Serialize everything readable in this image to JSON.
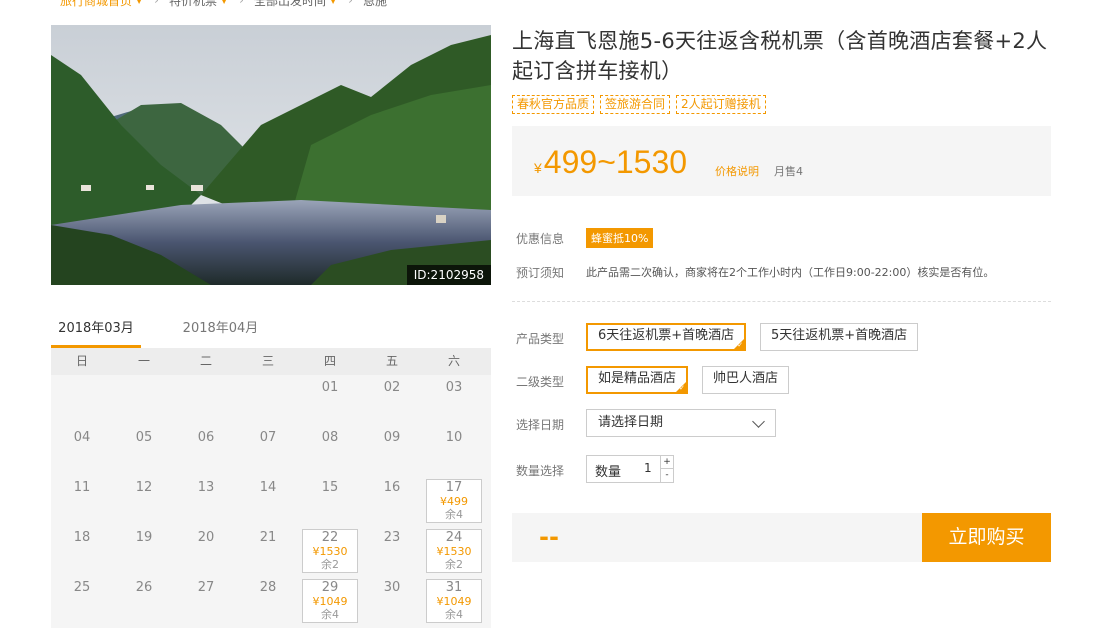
{
  "breadcrumb": [
    {
      "label": "旅行商城首页",
      "caret": "▼",
      "sep": "›"
    },
    {
      "label": "特价机票",
      "caret": "▼",
      "sep": "›"
    },
    {
      "label": "全部出发时间",
      "caret": "▼",
      "sep": "›"
    },
    {
      "label": "恩施",
      "caret": "",
      "sep": ""
    }
  ],
  "photo": {
    "id_label": "ID:2102958"
  },
  "calendar": {
    "tabs": [
      "2018年03月",
      "2018年04月"
    ],
    "weekdays": [
      "日",
      "一",
      "二",
      "三",
      "四",
      "五",
      "六"
    ],
    "cells": [
      {
        "day": ""
      },
      {
        "day": ""
      },
      {
        "day": ""
      },
      {
        "day": ""
      },
      {
        "day": "01"
      },
      {
        "day": "02"
      },
      {
        "day": "03"
      },
      {
        "day": "04"
      },
      {
        "day": "05"
      },
      {
        "day": "06"
      },
      {
        "day": "07"
      },
      {
        "day": "08"
      },
      {
        "day": "09"
      },
      {
        "day": "10"
      },
      {
        "day": "11"
      },
      {
        "day": "12"
      },
      {
        "day": "13"
      },
      {
        "day": "14"
      },
      {
        "day": "15"
      },
      {
        "day": "16"
      },
      {
        "day": "17",
        "price": "¥499",
        "remain": "余4"
      },
      {
        "day": "18"
      },
      {
        "day": "19"
      },
      {
        "day": "20"
      },
      {
        "day": "21"
      },
      {
        "day": "22",
        "price": "¥1530",
        "remain": "余2"
      },
      {
        "day": "23"
      },
      {
        "day": "24",
        "price": "¥1530",
        "remain": "余2"
      },
      {
        "day": "25"
      },
      {
        "day": "26"
      },
      {
        "day": "27"
      },
      {
        "day": "28"
      },
      {
        "day": "29",
        "price": "¥1049",
        "remain": "余4"
      },
      {
        "day": "30"
      },
      {
        "day": "31",
        "price": "¥1049",
        "remain": "余4"
      }
    ]
  },
  "product": {
    "title": "上海直飞恩施5-6天往返含税机票（含首晚酒店套餐+2人起订含拼车接机）",
    "tags": [
      "春秋官方品质",
      "签旅游合同",
      "2人起订赠接机"
    ],
    "price_symbol": "¥",
    "price_range": "499~1530",
    "price_note": "价格说明",
    "monthly_sales": "月售4"
  },
  "info": {
    "promo_label": "优惠信息",
    "promo_badge": "蜂蜜抵10%",
    "notice_label": "预订须知",
    "notice_text": "此产品需二次确认，商家将在2个工作小时内（工作日9:00-22:00）核实是否有位。"
  },
  "options": {
    "type_label": "产品类型",
    "types": [
      "6天往返机票+首晚酒店",
      "5天往返机票+首晚酒店"
    ],
    "sub_label": "二级类型",
    "subs": [
      "如是精品酒店",
      "帅巴人酒店"
    ],
    "date_label": "选择日期",
    "date_placeholder": "请选择日期",
    "qty_label": "数量选择",
    "qty_inner_label": "数量",
    "qty_value": "1",
    "plus": "+",
    "minus": "-"
  },
  "checkout": {
    "total": "--",
    "buy_label": "立即购买"
  },
  "colors": {
    "accent": "#f39800"
  }
}
